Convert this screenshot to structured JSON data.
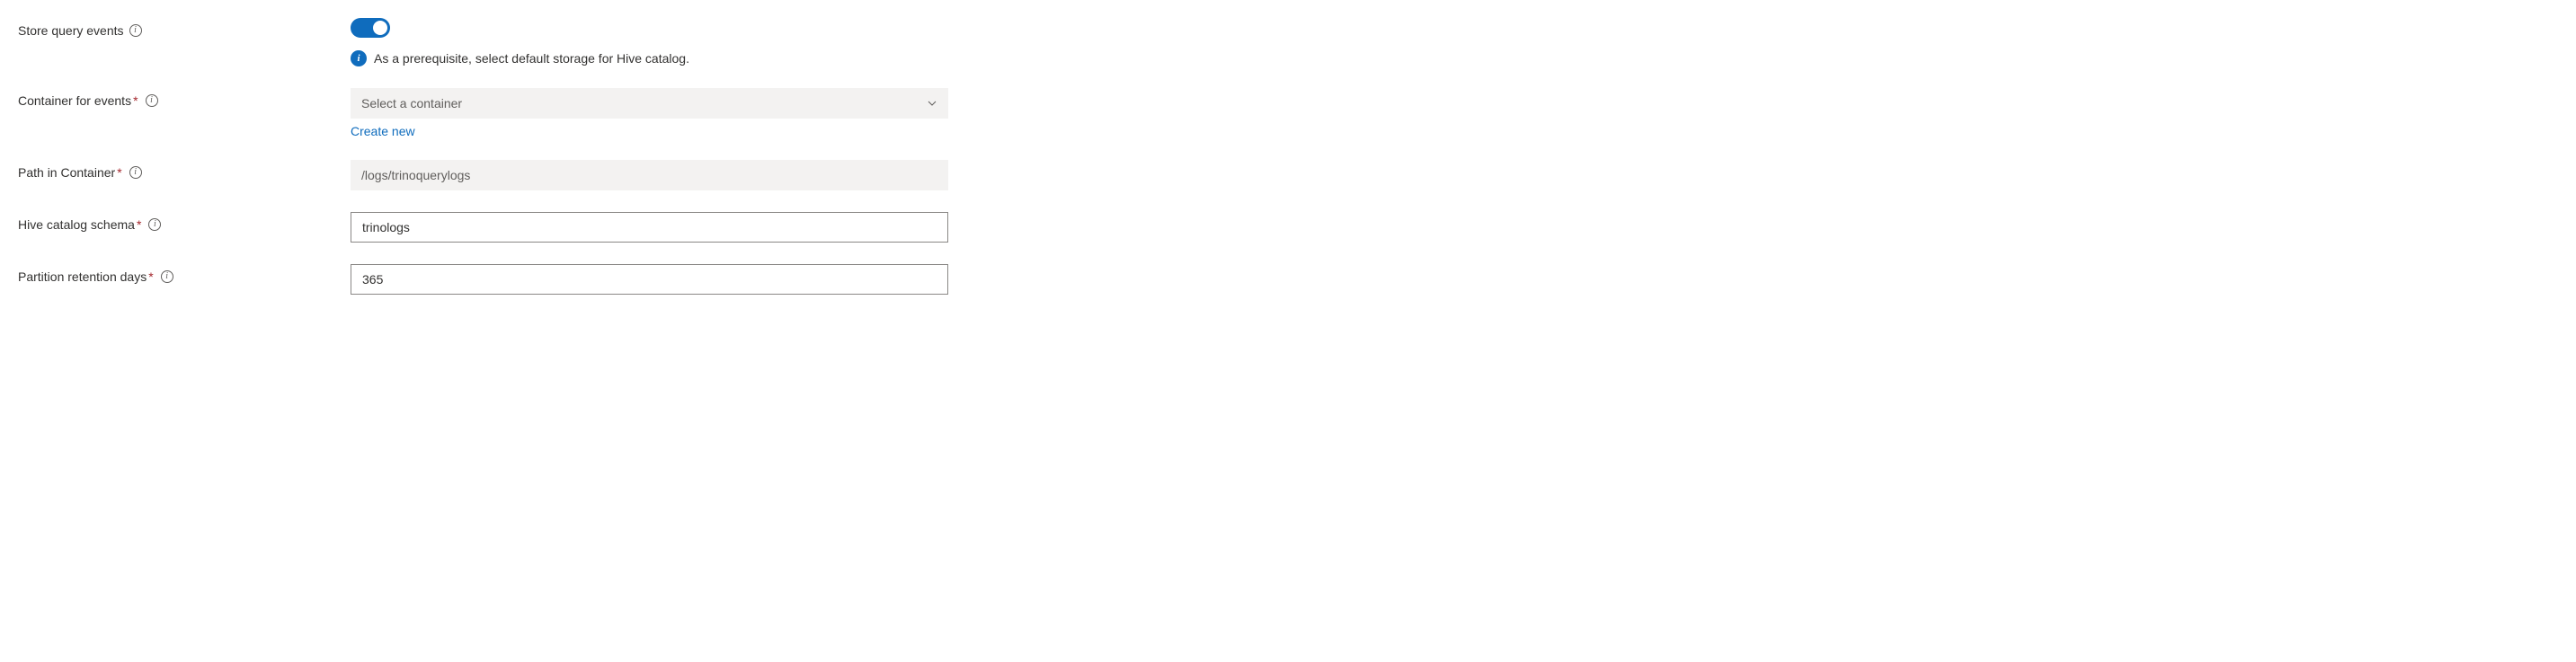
{
  "colors": {
    "accent": "#0F6CBD",
    "required": "#a4262c"
  },
  "storeQueryEvents": {
    "label": "Store query events",
    "enabled": true,
    "callout": "As a prerequisite, select default storage for Hive catalog."
  },
  "containerForEvents": {
    "label": "Container for events",
    "required": true,
    "placeholder": "Select a container",
    "createNewLabel": "Create new"
  },
  "pathInContainer": {
    "label": "Path in Container",
    "required": true,
    "value": "/logs/trinoquerylogs"
  },
  "hiveCatalogSchema": {
    "label": "Hive catalog schema",
    "required": true,
    "value": "trinologs"
  },
  "partitionRetentionDays": {
    "label": "Partition retention days",
    "required": true,
    "value": "365"
  }
}
